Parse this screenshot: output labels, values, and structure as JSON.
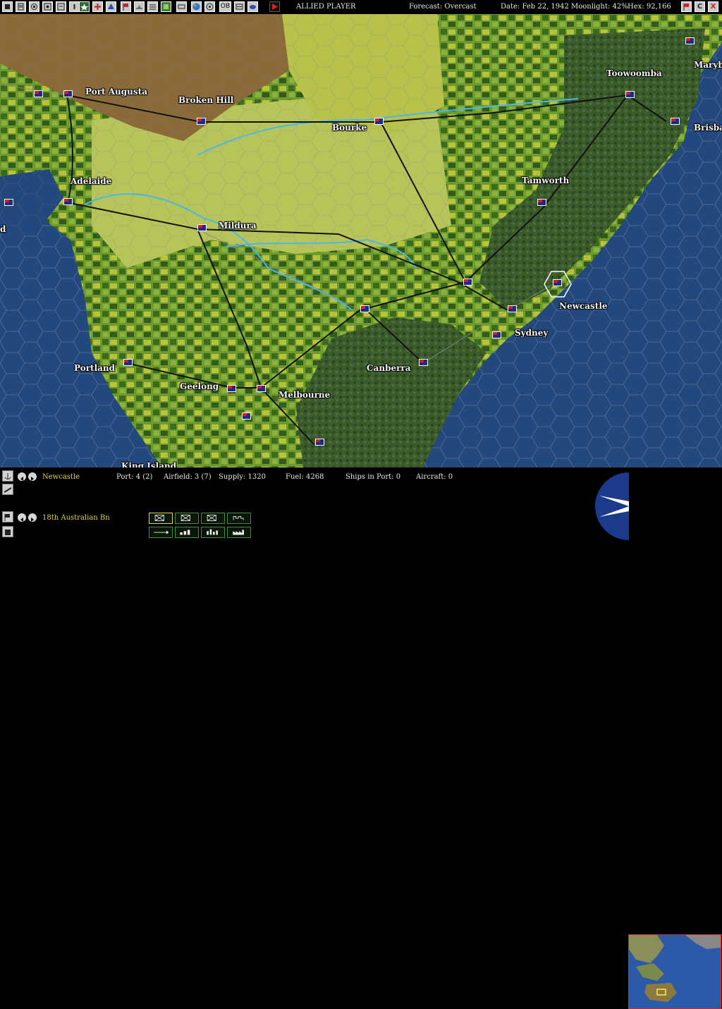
{
  "topbar": {
    "buttons": [
      "main-menu-icon",
      "report-icon",
      "replay-icon",
      "find-icon",
      "info-icon",
      "star-icon",
      "air-icon",
      "ship-icon",
      "flag-icon",
      "supply-icon",
      "map-icon",
      "sort-icon",
      "globe-icon",
      "ob-icon",
      "list-icon",
      "cloud-icon",
      "end-turn-icon"
    ],
    "ob_label": "OB",
    "player": "ALLIED PLAYER",
    "forecast": "Forecast: Overcast",
    "date": "Date: Feb 22, 1942",
    "moonlight": "Moonlight: 42%",
    "hex": "Hex: 92,166",
    "right_buttons": [
      {
        "name": "flag-toggle-button",
        "label": ""
      },
      {
        "name": "c-button",
        "label": "C"
      },
      {
        "name": "close-button",
        "label": "X"
      }
    ]
  },
  "map": {
    "cities": {
      "port_augusta": "Port Augusta",
      "broken_hill": "Broken Hill",
      "bourke": "Bourke",
      "toowoomba": "Toowoomba",
      "maryborough": "Maryb",
      "brisbane": "Brisba",
      "adelaide": "Adelaide",
      "tamworth": "Tamworth",
      "mildura": "Mildura",
      "newcastle": "Newcastle",
      "sydney": "Sydney",
      "canberra": "Canberra",
      "portland": "Portland",
      "geelong": "Geelong",
      "melbourne": "Melbourne",
      "king_island": "King Island",
      "left_edge": "d"
    }
  },
  "panel": {
    "location": {
      "name": "Newcastle",
      "port": "Port: 4 (2)",
      "airfield": "Airfield: 3 (7)",
      "supply": "Supply: 1320",
      "fuel": "Fuel: 4268",
      "ships_in_port": "Ships in Port: 0",
      "aircraft": "Aircraft: 0"
    },
    "unit": {
      "name": "18th Australian Bn"
    },
    "colors": {
      "highlight": "#e3d44a",
      "command_border": "#3a8f3a"
    }
  }
}
